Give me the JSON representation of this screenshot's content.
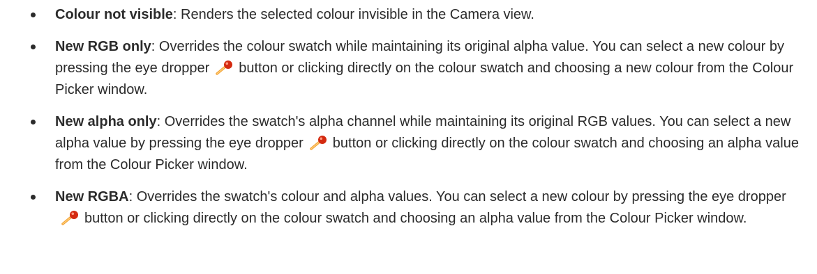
{
  "items": [
    {
      "term": "Colour not visible",
      "sep": ": ",
      "text": "Renders the selected colour invisible in the Camera view."
    },
    {
      "term": "New RGB only",
      "sep": ": ",
      "text_before": "Overrides the colour swatch while maintaining its original alpha value. You can select a new colour by pressing the eye dropper",
      "icon": "eye-dropper-icon",
      "text_after": "button or clicking directly on the colour swatch and choosing a new colour from the Colour Picker window."
    },
    {
      "term": "New alpha only",
      "sep": ": ",
      "text_before": "Overrides the swatch's alpha channel while maintaining its original RGB values. You can select a new alpha value by pressing the eye dropper",
      "icon": "eye-dropper-icon",
      "text_after": "button or clicking directly on the colour swatch and choosing an alpha value from the Colour Picker window."
    },
    {
      "term": "New RGBA",
      "sep": ": ",
      "text_before": "Overrides the swatch's colour and alpha values. You can select a new colour by pressing the eye dropper",
      "icon": "eye-dropper-icon",
      "text_after": "button or clicking directly on the colour swatch and choosing an alpha value from the Colour Picker window."
    }
  ],
  "colors": {
    "text": "#2b2b2b",
    "dropper_tip": "#d42a10",
    "dropper_body": "#f2a33a"
  }
}
